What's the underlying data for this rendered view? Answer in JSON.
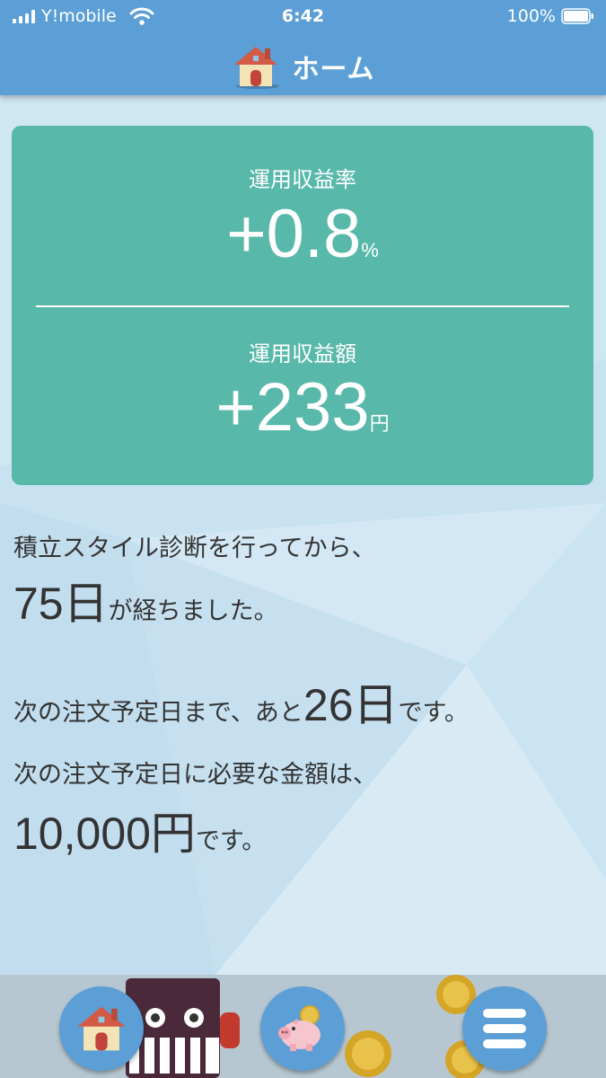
{
  "status_bar": {
    "carrier": "Y!mobile",
    "time": "6:42",
    "battery": "100%"
  },
  "header": {
    "title": "ホーム",
    "icon": "house-icon"
  },
  "profit_card": {
    "rate_label": "運用収益率",
    "rate_value": "+0.8",
    "rate_unit": "%",
    "amount_label": "運用収益額",
    "amount_value": "+233",
    "amount_unit": "円"
  },
  "info": {
    "diagnosis_line": "積立スタイル診断を行ってから、",
    "days_elapsed": "75日",
    "days_elapsed_suffix": "が経ちました。",
    "next_order_prefix": "次の注文予定日まで、あと",
    "days_remaining": "26日",
    "next_order_suffix": "です。",
    "amount_line": "次の注文予定日に必要な金額は、",
    "required_amount": "10,000円",
    "amount_suffix": "です。"
  },
  "bottom_nav": {
    "items": [
      {
        "icon": "house-icon"
      },
      {
        "icon": "piggy-bank-icon"
      },
      {
        "icon": "menu-icon"
      }
    ]
  },
  "colors": {
    "header": "#5b9fd6",
    "card": "#58b8aa",
    "text": "#333333",
    "background": "#c9e3f2"
  }
}
